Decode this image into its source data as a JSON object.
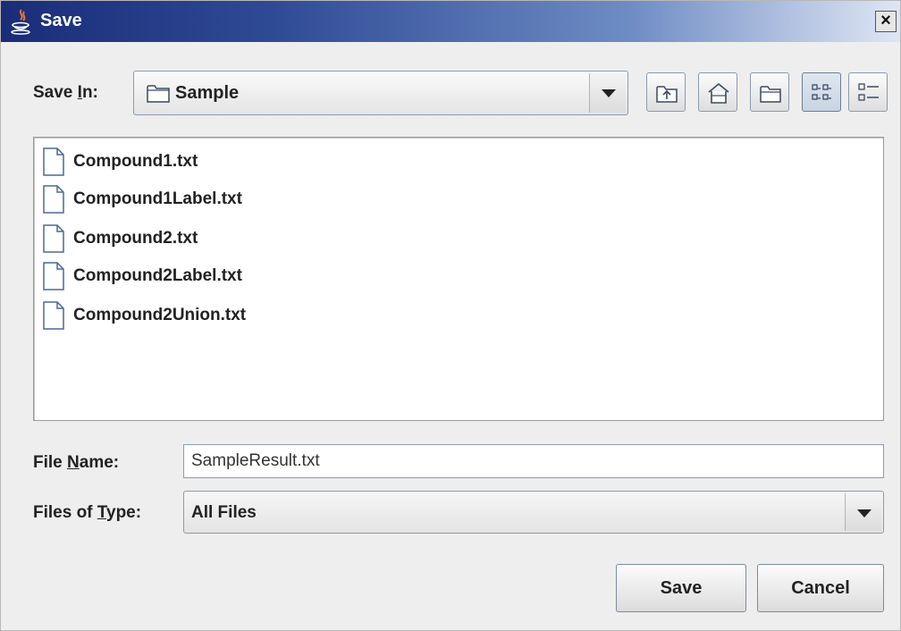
{
  "window": {
    "title": "Save",
    "close_glyph": "×"
  },
  "save_in": {
    "label_prefix": "Save ",
    "label_mnemonic": "I",
    "label_suffix": "n:",
    "value": "Sample"
  },
  "toolbar": {
    "buttons": [
      {
        "name": "up-one-level",
        "icon": "up-folder-icon"
      },
      {
        "name": "home",
        "icon": "home-icon"
      },
      {
        "name": "new-folder",
        "icon": "new-folder-icon"
      },
      {
        "name": "list-view",
        "icon": "list-view-icon",
        "active": true
      },
      {
        "name": "details-view",
        "icon": "details-view-icon"
      }
    ]
  },
  "files": [
    "Compound1.txt",
    "Compound1Label.txt",
    "Compound2.txt",
    "Compound2Label.txt",
    "Compound2Union.txt"
  ],
  "file_name": {
    "label_prefix": "File ",
    "label_mnemonic": "N",
    "label_suffix": "ame:",
    "value": "SampleResult.txt"
  },
  "file_type": {
    "label_prefix": "Files of ",
    "label_mnemonic": "T",
    "label_suffix": "ype:",
    "value": "All Files"
  },
  "actions": {
    "save_label": "Save",
    "cancel_label": "Cancel"
  }
}
